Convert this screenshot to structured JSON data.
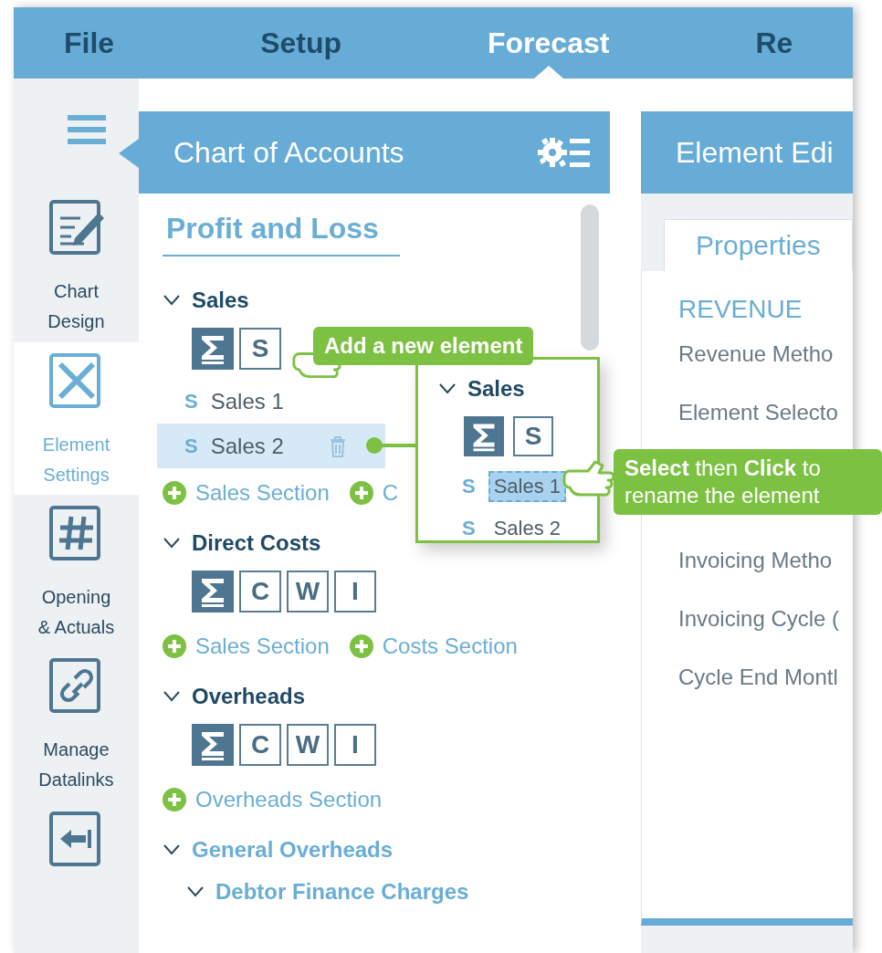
{
  "menu": [
    {
      "label": "File",
      "selected": false
    },
    {
      "label": "Setup",
      "selected": false
    },
    {
      "label": "Forecast",
      "selected": true
    },
    {
      "label": "Re",
      "selected": false
    }
  ],
  "sidebar": {
    "items": [
      {
        "kind": "chart-design",
        "lines": [
          "Chart",
          "Design"
        ],
        "selected": false
      },
      {
        "kind": "element-settings",
        "lines": [
          "Element",
          "Settings"
        ],
        "selected": true
      },
      {
        "kind": "opening",
        "lines": [
          "Opening",
          "& Actuals"
        ],
        "selected": false
      },
      {
        "kind": "datalinks",
        "lines": [
          "Manage",
          "Datalinks"
        ],
        "selected": false
      },
      {
        "kind": "exit",
        "selected": false
      }
    ]
  },
  "chart_of_accounts": {
    "title": "Chart of Accounts",
    "section": "Profit and Loss",
    "groups": [
      {
        "kind": "category",
        "name": "Sales",
        "expanded": true,
        "buttons": [
          {
            "kind": "sum"
          },
          {
            "kind": "letter",
            "label": "S"
          }
        ],
        "elements": [
          {
            "prefix": "S",
            "label": "Sales 1",
            "selected": false
          },
          {
            "prefix": "S",
            "label": "Sales 2",
            "selected": true
          }
        ],
        "adds": [
          "Sales Section",
          "C"
        ]
      },
      {
        "kind": "category",
        "name": "Direct Costs",
        "expanded": true,
        "buttons": [
          {
            "kind": "sum"
          },
          {
            "kind": "letter",
            "label": "C"
          },
          {
            "kind": "letter",
            "label": "W"
          },
          {
            "kind": "letter",
            "label": "I"
          }
        ],
        "adds": [
          "Sales Section",
          "Costs Section"
        ]
      },
      {
        "kind": "category",
        "name": "Overheads",
        "expanded": true,
        "buttons": [
          {
            "kind": "sum"
          },
          {
            "kind": "letter",
            "label": "C"
          },
          {
            "kind": "letter",
            "label": "W"
          },
          {
            "kind": "letter",
            "label": "I"
          }
        ],
        "adds": [
          "Overheads Section"
        ]
      },
      {
        "kind": "subsection",
        "name": "General Overheads",
        "expanded": true,
        "children": [
          {
            "name": "Debtor Finance Charges",
            "expanded": true
          }
        ]
      }
    ]
  },
  "element_editor": {
    "title": "Element Edi",
    "tabs": [
      {
        "label": "Properties",
        "selected": true
      }
    ],
    "heading": "REVENUE",
    "fields": [
      "Revenue Metho",
      "Element Selecto",
      "Invoicing Metho",
      "Invoicing Cycle (",
      "Cycle End Montl"
    ]
  },
  "zoom_popup": {
    "name": "Sales",
    "expanded": true,
    "buttons": [
      {
        "kind": "sum"
      },
      {
        "kind": "letter",
        "label": "S"
      }
    ],
    "elements": [
      {
        "prefix": "S",
        "label": "Sales 1",
        "selected": true
      },
      {
        "prefix": "S",
        "label": "Sales 2",
        "selected": false
      }
    ]
  },
  "callouts": [
    {
      "text": "Add a new element"
    },
    {
      "text": "**Select** then **Click** to rename the element"
    }
  ]
}
